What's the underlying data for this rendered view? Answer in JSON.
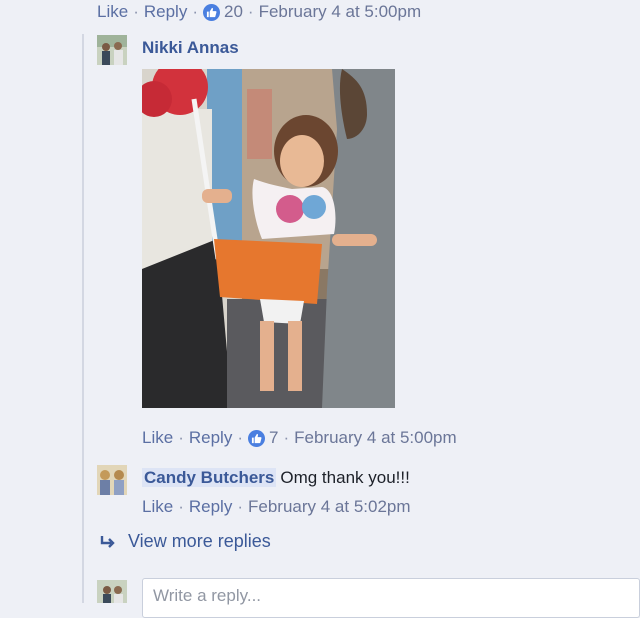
{
  "top_actions": {
    "like": "Like",
    "reply": "Reply",
    "reaction_count": "20",
    "timestamp": "February 4 at 5:00pm"
  },
  "reply1": {
    "author": "Nikki Annas",
    "actions": {
      "like": "Like",
      "reply": "Reply",
      "reaction_count": "7",
      "timestamp": "February 4 at 5:00pm"
    }
  },
  "reply2": {
    "author": "Candy Butchers",
    "text": "Omg thank you!!!",
    "actions": {
      "like": "Like",
      "reply": "Reply",
      "timestamp": "February 4 at 5:02pm"
    }
  },
  "view_more": "View more replies",
  "reply_input": {
    "placeholder": "Write a reply..."
  },
  "colors": {
    "link": "#3b5998",
    "meta": "#6b7698",
    "like_badge": "#4a7fe0",
    "background": "#eef0f6"
  }
}
